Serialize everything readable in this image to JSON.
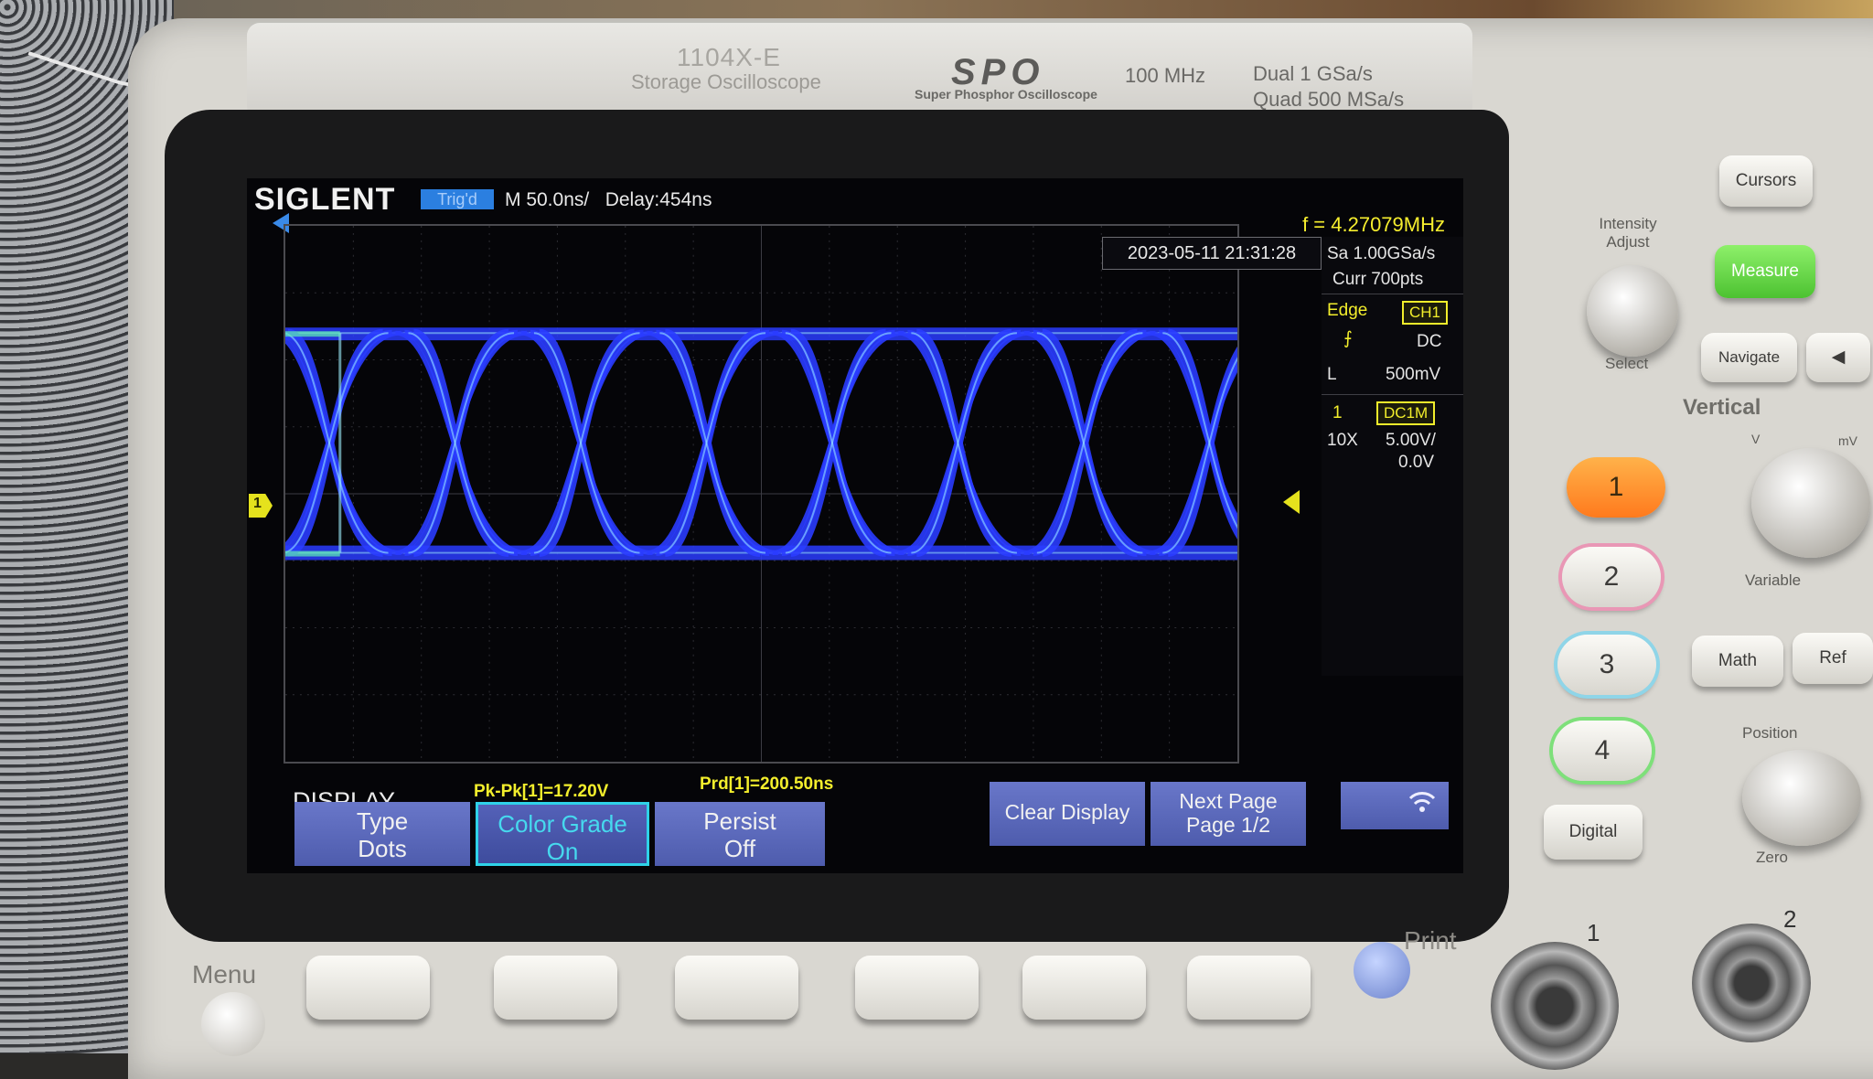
{
  "panel_label": {
    "model": "1104X-E",
    "storage": "Storage Oscilloscope",
    "spo_logo": "SPO",
    "spo_sub": "Super Phosphor Oscilloscope",
    "bandwidth": "100 MHz",
    "rate_dual": "Dual   1 GSa/s",
    "rate_quad": "Quad  500 MSa/s"
  },
  "screen": {
    "brand": "SIGLENT",
    "trigger_status": "Trig'd",
    "timebase": "M 50.0ns/   Delay:454ns",
    "frequency": "f = 4.27079MHz",
    "datetime": "2023-05-11 21:31:28",
    "sample_rate": "Sa 1.00GSa/s",
    "curr_pts": "Curr 700pts",
    "trigger": {
      "type": "Edge",
      "source": "CH1",
      "slope_icon": "rising-edge-icon",
      "coupling": "DC",
      "level_prefix": "L",
      "level": "500mV"
    },
    "channel": {
      "number": "1",
      "coupling": "DC1M",
      "probe": "10X",
      "scale": "5.00V/",
      "offset": "0.0V"
    },
    "channel_marker": "1",
    "menu_title": "DISPLAY",
    "measurements": {
      "pkpk": "Pk-Pk[1]=17.20V",
      "period": "Prd[1]=200.50ns"
    },
    "softkeys": [
      {
        "line1": "Type",
        "line2": "Dots"
      },
      {
        "line1": "Color Grade",
        "line2": "On"
      },
      {
        "line1": "Persist",
        "line2": "Off"
      },
      {
        "line1": "Clear Display",
        "line2": ""
      },
      {
        "line1": "Next Page",
        "line2": "Page 1/2"
      }
    ],
    "wifi_icon": "wifi-icon",
    "trace_color": "#2a3cff",
    "hot_color": "#9ff0ff"
  },
  "front_panel": {
    "menu_label": "Menu",
    "print_label": "Print",
    "intensity_label": "Intensity Adjust",
    "select_label": "Select",
    "cursors": "Cursors",
    "measure": "Measure",
    "navigate": "Navigate",
    "vertical": "Vertical",
    "variable": "Variable",
    "math": "Math",
    "ref": "Ref",
    "position": "Position",
    "zero": "Zero",
    "digital": "Digital",
    "channels": [
      "1",
      "2",
      "3",
      "4"
    ],
    "bnc_labels": [
      "1",
      "2"
    ],
    "volt_v": "V",
    "volt_mv": "mV"
  }
}
